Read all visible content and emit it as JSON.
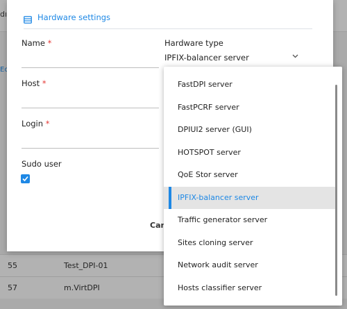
{
  "background": {
    "top_text": "dı",
    "side_link": "Ec",
    "rows": [
      {
        "id": "55",
        "name": "Test_DPI-01"
      },
      {
        "id": "57",
        "name": "m.VirtDPI"
      }
    ]
  },
  "modal": {
    "title": "Hardware settings",
    "title_icon": "server-icon",
    "fields": {
      "name": {
        "label": "Name",
        "required_mark": "*"
      },
      "host": {
        "label": "Host",
        "required_mark": "*"
      },
      "login": {
        "label": "Login",
        "required_mark": "*"
      },
      "sudo": {
        "label": "Sudo user",
        "checked": true
      }
    },
    "hardware_type": {
      "label": "Hardware type",
      "value": "IPFIX-balancer server"
    },
    "cancel_label": "Cancel"
  },
  "dropdown": {
    "items": [
      "FastDPI server",
      "FastPCRF server",
      "DPIUI2 server (GUI)",
      "HOTSPOT server",
      "QoE Stor server",
      "IPFIX-balancer server",
      "Traffic generator server",
      "Sites cloning server",
      "Network audit server",
      "Hosts classifier server"
    ],
    "selected": "IPFIX-balancer server"
  },
  "colors": {
    "accent": "#1e88e5",
    "required": "#e53935"
  }
}
